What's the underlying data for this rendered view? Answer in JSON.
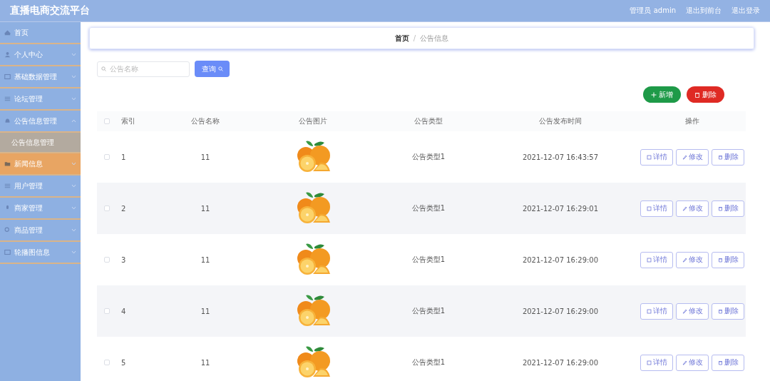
{
  "header": {
    "title": "直播电商交流平台",
    "links": [
      "管理员 admin",
      "退出到前台",
      "退出登录"
    ]
  },
  "sidebar": {
    "items": [
      {
        "label": "首页",
        "selected": false
      },
      {
        "label": "个人中心",
        "expanded": false,
        "selected": false
      },
      {
        "label": "基础数据管理",
        "expanded": false,
        "selected": false
      },
      {
        "label": "论坛管理",
        "expanded": false,
        "selected": false
      },
      {
        "label": "公告信息管理",
        "expanded": true,
        "selected": false,
        "children": [
          {
            "label": "公告信息管理",
            "selected": false
          }
        ]
      },
      {
        "label": "新闻信息",
        "expanded": false,
        "selected": true
      },
      {
        "label": "用户管理",
        "expanded": false,
        "selected": false
      },
      {
        "label": "商家管理",
        "expanded": false,
        "selected": false
      },
      {
        "label": "商品管理",
        "expanded": false,
        "selected": false
      },
      {
        "label": "轮播图信息",
        "expanded": false,
        "selected": false
      }
    ]
  },
  "breadcrumb": [
    "首页",
    "/",
    "公告信息"
  ],
  "search": {
    "placeholder": "公告名称",
    "button": "查询"
  },
  "actions": [
    {
      "label": "新增",
      "kind": "add"
    },
    {
      "label": "删除",
      "kind": "delete"
    }
  ],
  "table": {
    "checked": false,
    "columns": [
      "索引",
      "公告名称",
      "公告图片",
      "公告类型",
      "公告发布时间",
      "操作"
    ],
    "rows": [
      {
        "checked": false,
        "index": "1",
        "name": "11",
        "type": "公告类型1",
        "time": "2021-12-07 16:43:57",
        "actions": [
          "详情",
          "修改",
          "删除"
        ]
      },
      {
        "checked": false,
        "index": "2",
        "name": "11",
        "type": "公告类型1",
        "time": "2021-12-07 16:29:01",
        "actions": [
          "详情",
          "修改",
          "删除"
        ]
      },
      {
        "checked": false,
        "index": "3",
        "name": "11",
        "type": "公告类型1",
        "time": "2021-12-07 16:29:00",
        "actions": [
          "详情",
          "修改",
          "删除"
        ]
      },
      {
        "checked": false,
        "index": "4",
        "name": "11",
        "type": "公告类型1",
        "time": "2021-12-07 16:29:00",
        "actions": [
          "详情",
          "修改",
          "删除"
        ]
      },
      {
        "checked": false,
        "index": "5",
        "name": "11",
        "type": "公告类型1",
        "time": "2021-12-07 16:29:00",
        "actions": [
          "详情",
          "修改",
          "删除"
        ]
      }
    ]
  }
}
